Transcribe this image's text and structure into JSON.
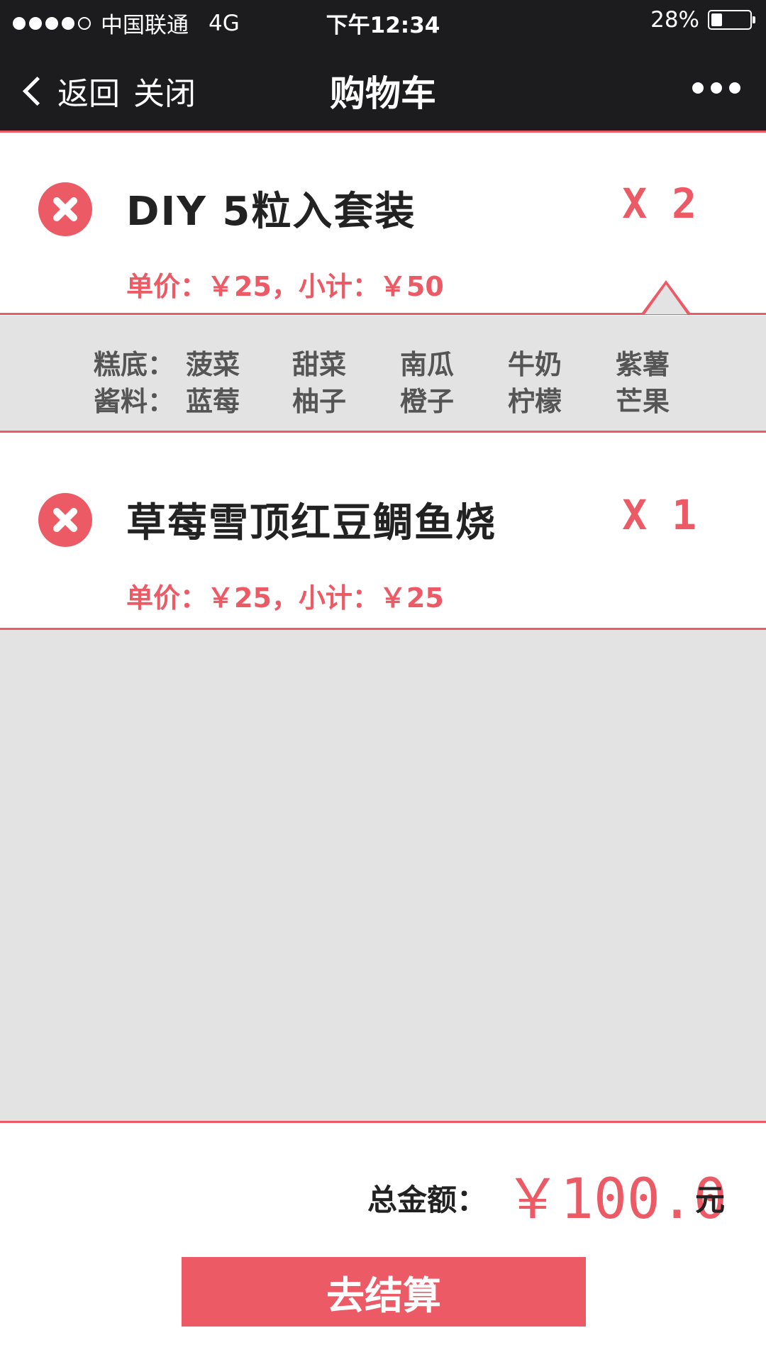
{
  "status_bar": {
    "carrier": "中国联通",
    "network": "4G",
    "time": "下午12:34",
    "battery_percent": "28%",
    "battery_level": 0.28,
    "signal_bars": 4
  },
  "navbar": {
    "back_label": "返回",
    "close_label": "关闭",
    "title": "购物车",
    "more_icon": "more-dots-icon"
  },
  "cart": {
    "items": [
      {
        "name": "DIY 5粒入套装",
        "quantity": "X 2",
        "price_line": "单价：￥25，小计：￥50",
        "options": {
          "base_label": "糕底：",
          "base": [
            "菠菜",
            "甜菜",
            "南瓜",
            "牛奶",
            "紫薯"
          ],
          "sauce_label": "酱料：",
          "sauce": [
            "蓝莓",
            "柚子",
            "橙子",
            "柠檬",
            "芒果"
          ]
        }
      },
      {
        "name": "草莓雪顶红豆鲷鱼烧",
        "quantity": "X 1",
        "price_line": "单价：￥25，小计：￥25"
      }
    ]
  },
  "footer": {
    "total_label": "总金额：",
    "total_value": "￥100.0",
    "total_unit": "元",
    "checkout_label": "去结算"
  },
  "colors": {
    "accent": "#ec5a66",
    "header_bg": "#1c1c1e",
    "panel_bg": "#e3e3e4"
  }
}
